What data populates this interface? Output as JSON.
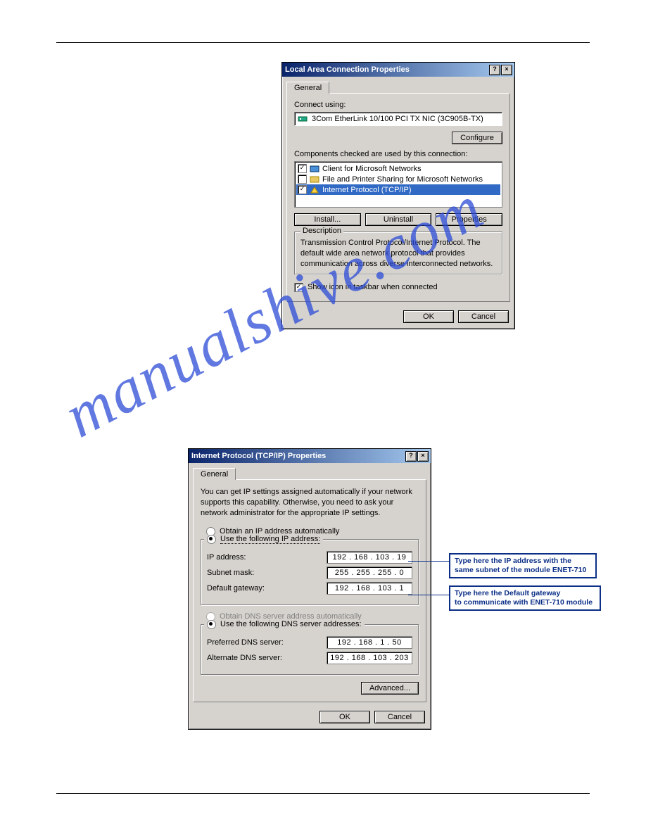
{
  "dialog1": {
    "title": "Local Area Connection Properties",
    "tab": "General",
    "connect_using_label": "Connect using:",
    "adapter": "3Com EtherLink 10/100 PCI TX NIC (3C905B-TX)",
    "configure_btn": "Configure",
    "components_label": "Components checked are used by this connection:",
    "items": [
      {
        "checked": true,
        "label": "Client for Microsoft Networks",
        "icon": "client"
      },
      {
        "checked": false,
        "label": "File and Printer Sharing for Microsoft Networks",
        "icon": "share"
      },
      {
        "checked": true,
        "label": "Internet Protocol (TCP/IP)",
        "icon": "protocol",
        "selected": true
      }
    ],
    "install_btn": "Install...",
    "uninstall_btn": "Uninstall",
    "properties_btn": "Properties",
    "desc_legend": "Description",
    "desc_text": "Transmission Control Protocol/Internet Protocol. The default wide area network protocol that provides communication across diverse interconnected networks.",
    "show_icon_label": "Show icon in taskbar when connected",
    "ok_btn": "OK",
    "cancel_btn": "Cancel"
  },
  "dialog2": {
    "title": "Internet Protocol (TCP/IP) Properties",
    "tab": "General",
    "intro": "You can get IP settings assigned automatically if your network supports this capability. Otherwise, you need to ask your network administrator for the appropriate IP settings.",
    "radio_auto": "Obtain an IP address automatically",
    "radio_static": "Use the following IP address:",
    "ip_label": "IP address:",
    "ip_value": "192 . 168 . 103 .  19",
    "subnet_label": "Subnet mask:",
    "subnet_value": "255 . 255 . 255 .   0",
    "gw_label": "Default gateway:",
    "gw_value": "192 . 168 . 103 .   1",
    "dns_auto": "Obtain DNS server address automatically",
    "dns_static": "Use the following DNS server addresses:",
    "pref_dns_label": "Preferred DNS server:",
    "pref_dns_value": "192 . 168 .   1 .  50",
    "alt_dns_label": "Alternate DNS server:",
    "alt_dns_value": "192 . 168 . 103 . 203",
    "advanced_btn": "Advanced...",
    "ok_btn": "OK",
    "cancel_btn": "Cancel"
  },
  "callouts": {
    "ip_line1": "Type here the IP address with the",
    "ip_line2": "same subnet of the module ENET-710",
    "gw_line1": "Type here the Default gateway",
    "gw_line2": "to communicate with ENET-710 module"
  },
  "watermark": "manualshive.com"
}
